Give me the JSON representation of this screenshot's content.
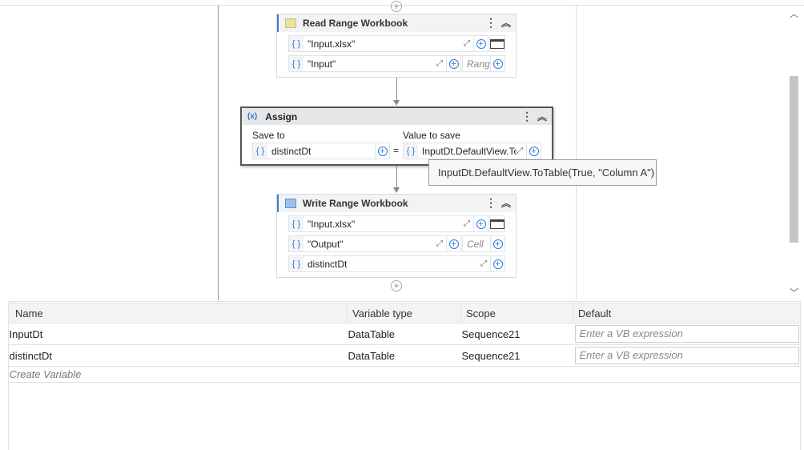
{
  "activities": [
    {
      "title": "Read Range Workbook",
      "fields": [
        {
          "value": "\"Input.xlsx\""
        },
        {
          "value": "\"Input\"",
          "extra_placeholder": "Range"
        }
      ]
    },
    {
      "title": "Assign",
      "save_to_label": "Save to",
      "value_label": "Value to save",
      "save_to": "distinctDt",
      "equals": "=",
      "value": "InputDt.DefaultView.ToTable(True, \"Column A\")",
      "value_truncated": "InputDt.DefaultView.To"
    },
    {
      "title": "Write Range Workbook",
      "fields": [
        {
          "value": "\"Input.xlsx\""
        },
        {
          "value": "\"Output\"",
          "extra_placeholder": "Cell"
        },
        {
          "value": "distinctDt"
        }
      ]
    }
  ],
  "tooltip": "InputDt.DefaultView.ToTable(True, \"Column A\")",
  "variables": {
    "headers": [
      "Name",
      "Variable type",
      "Scope",
      "Default"
    ],
    "rows": [
      {
        "name": "InputDt",
        "type": "DataTable",
        "scope": "Sequence21",
        "default_placeholder": "Enter a VB expression"
      },
      {
        "name": "distinctDt",
        "type": "DataTable",
        "scope": "Sequence21",
        "default_placeholder": "Enter a VB expression"
      }
    ],
    "create": "Create Variable"
  },
  "icons": {
    "braces": "{ }",
    "plus": "+",
    "menu": "⋮",
    "collapse": "︽",
    "expand": "⤢",
    "assign": "(x)"
  }
}
